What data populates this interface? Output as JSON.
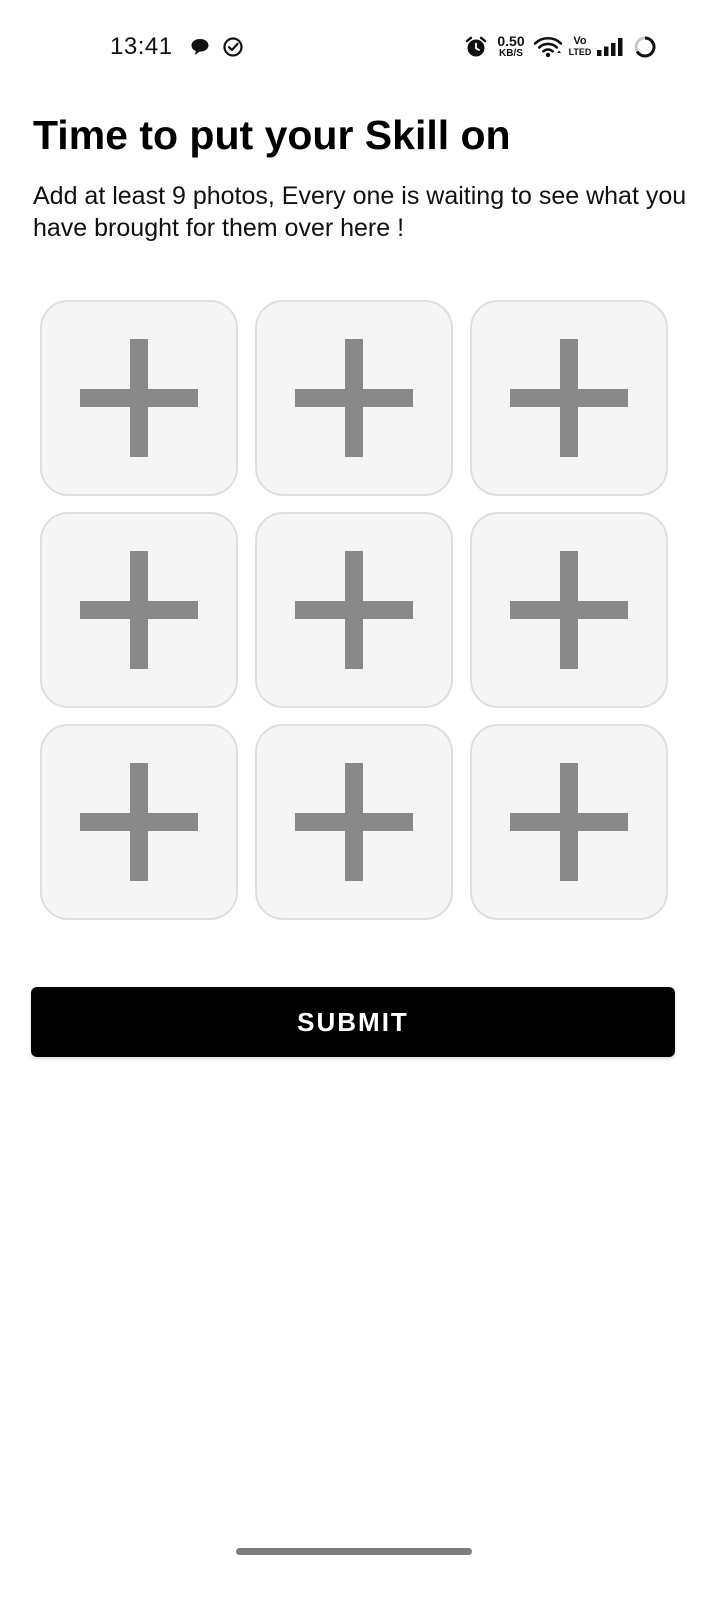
{
  "status_bar": {
    "time": "13:41",
    "net_speed_value": "0.50",
    "net_speed_unit": "KB/S",
    "volte_top": "Vo",
    "volte_bottom": "LTED",
    "icons": [
      "chat-bubble-icon",
      "check-circle-icon",
      "alarm-icon",
      "wifi-icon",
      "signal-icon",
      "battery-icon"
    ]
  },
  "header": {
    "title": "Time to put your Skill on",
    "subtitle": "Add at least 9 photos, Every one is waiting to see what you have brought for them over here !"
  },
  "photo_slots": [
    {
      "icon": "plus-icon"
    },
    {
      "icon": "plus-icon"
    },
    {
      "icon": "plus-icon"
    },
    {
      "icon": "plus-icon"
    },
    {
      "icon": "plus-icon"
    },
    {
      "icon": "plus-icon"
    },
    {
      "icon": "plus-icon"
    },
    {
      "icon": "plus-icon"
    },
    {
      "icon": "plus-icon"
    }
  ],
  "actions": {
    "submit_label": "SUBMIT"
  },
  "colors": {
    "slot_background": "#f5f5f5",
    "slot_border": "#dedede",
    "plus_icon": "#898989",
    "button_background": "#000000",
    "button_text": "#ffffff"
  }
}
